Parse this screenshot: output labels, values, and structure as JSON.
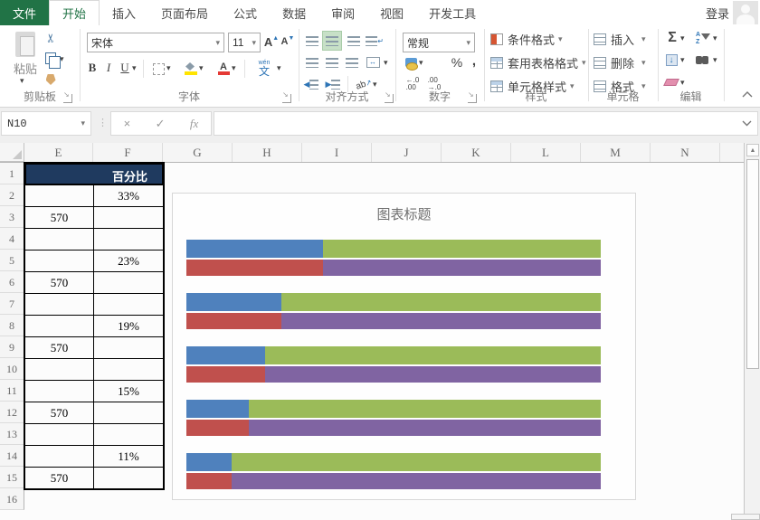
{
  "tabs": {
    "file": "文件",
    "items": [
      {
        "label": "开始",
        "active": true
      },
      {
        "label": "插入",
        "active": false
      },
      {
        "label": "页面布局",
        "active": false
      },
      {
        "label": "公式",
        "active": false
      },
      {
        "label": "数据",
        "active": false
      },
      {
        "label": "审阅",
        "active": false
      },
      {
        "label": "视图",
        "active": false
      },
      {
        "label": "开发工具",
        "active": false
      }
    ],
    "signin": "登录"
  },
  "ribbon": {
    "clipboard": {
      "label": "剪贴板",
      "paste": "粘贴"
    },
    "font": {
      "label": "字体",
      "name": "宋体",
      "size": "11",
      "grow": "A",
      "shrink": "A",
      "bold": "B",
      "italic": "I",
      "underline": "U",
      "phonetic_guide": "wén",
      "phonetic": "文"
    },
    "alignment": {
      "label": "对齐方式",
      "orientation_text": "ab"
    },
    "number": {
      "label": "数字",
      "format": "常规",
      "percent": "%",
      "comma": ",",
      "inc_top": "←.0",
      "inc_bot": ".00",
      "dec_top": ".00",
      "dec_bot": "→.0"
    },
    "styles": {
      "label": "样式",
      "items": [
        "条件格式",
        "套用表格格式",
        "单元格样式"
      ]
    },
    "cells": {
      "label": "单元格",
      "items": [
        "插入",
        "删除",
        "格式"
      ]
    },
    "editing": {
      "label": "编辑",
      "sum": "Σ",
      "sort_a": "A",
      "sort_z": "Z"
    }
  },
  "formula_bar": {
    "name_box": "N10",
    "cancel": "×",
    "enter": "✓",
    "fx": "fx",
    "input_value": ""
  },
  "sheet": {
    "columns": [
      "E",
      "F",
      "G",
      "H",
      "I",
      "J",
      "K",
      "L",
      "M",
      "N"
    ],
    "row_numbers": [
      "1",
      "2",
      "3",
      "4",
      "5",
      "6",
      "7",
      "8",
      "9",
      "10",
      "11",
      "12",
      "13",
      "14",
      "15",
      "16"
    ],
    "table": {
      "header": "百分比",
      "first_row": 1,
      "last_row": 15,
      "cells": [
        {
          "row": 2,
          "col": "F",
          "value": "33%"
        },
        {
          "row": 3,
          "col": "E",
          "value": "570"
        },
        {
          "row": 5,
          "col": "F",
          "value": "23%"
        },
        {
          "row": 6,
          "col": "E",
          "value": "570"
        },
        {
          "row": 8,
          "col": "F",
          "value": "19%"
        },
        {
          "row": 9,
          "col": "E",
          "value": "570"
        },
        {
          "row": 11,
          "col": "F",
          "value": "15%"
        },
        {
          "row": 12,
          "col": "E",
          "value": "570"
        },
        {
          "row": 14,
          "col": "F",
          "value": "11%"
        },
        {
          "row": 15,
          "col": "E",
          "value": "570"
        }
      ]
    }
  },
  "chart_data": {
    "type": "bar",
    "orientation": "horizontal",
    "stacked": true,
    "bars_per_category": 2,
    "title": "图表标题",
    "categories": [
      "1",
      "2",
      "3",
      "4",
      "5"
    ],
    "series": [
      {
        "name": "blue",
        "color": "#4F81BD",
        "values": [
          33,
          23,
          19,
          15,
          11
        ],
        "row": "top"
      },
      {
        "name": "green",
        "color": "#9BBB59",
        "values": [
          67,
          77,
          81,
          85,
          89
        ],
        "row": "top"
      },
      {
        "name": "red",
        "color": "#C0504D",
        "values": [
          33,
          23,
          19,
          15,
          11
        ],
        "row": "bottom"
      },
      {
        "name": "purple",
        "color": "#8064A2",
        "values": [
          67,
          77,
          81,
          85,
          89
        ],
        "row": "bottom"
      }
    ],
    "xlim": [
      0,
      100
    ],
    "legend": false,
    "gridlines": false,
    "axes_visible": false
  },
  "colors": {
    "brand_green": "#217346",
    "table_header_bg": "#1F3A5F",
    "selected_align_bg": "#C7E0C7"
  }
}
